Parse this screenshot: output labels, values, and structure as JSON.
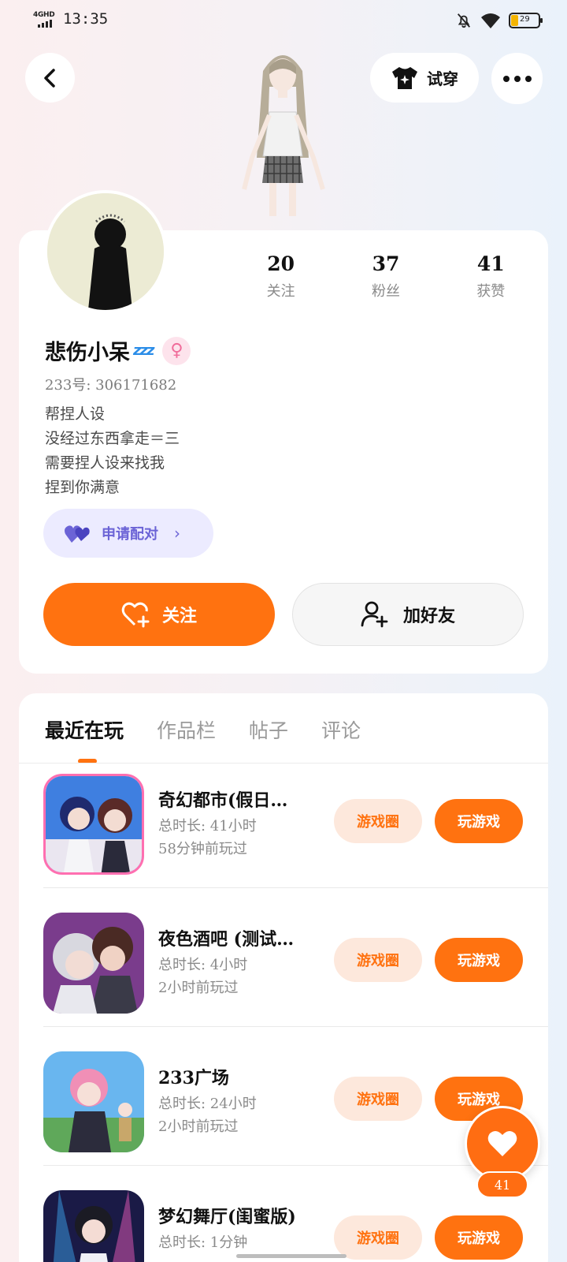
{
  "status_bar": {
    "network": "4GHD",
    "time": "13:35",
    "battery": "29"
  },
  "header": {
    "tryon_label": "试穿"
  },
  "profile": {
    "nickname": "悲伤小呆",
    "nickname_decoration": "zzz",
    "uid": "233号: 306171682",
    "bio": [
      "帮捏人设",
      "没经过东西拿走＝三",
      "需要捏人设来找我",
      "捏到你满意"
    ],
    "stats": [
      {
        "value": "20",
        "label": "关注"
      },
      {
        "value": "37",
        "label": "粉丝"
      },
      {
        "value": "41",
        "label": "获赞"
      }
    ],
    "pair_label": "申请配对",
    "follow_label": "关注",
    "add_friend_label": "加好友"
  },
  "tabs": [
    {
      "label": "最近在玩",
      "active": true
    },
    {
      "label": "作品栏",
      "active": false
    },
    {
      "label": "帖子",
      "active": false
    },
    {
      "label": "评论",
      "active": false
    }
  ],
  "games": [
    {
      "name": "奇幻都市(假日…",
      "total": "总时长: 41小时",
      "last": "58分钟前玩过",
      "circle_label": "游戏圈",
      "play_label": "玩游戏"
    },
    {
      "name": "夜色酒吧 (测试…",
      "total": "总时长: 4小时",
      "last": "2小时前玩过",
      "circle_label": "游戏圈",
      "play_label": "玩游戏"
    },
    {
      "name": "233广场",
      "total": "总时长: 24小时",
      "last": "2小时前玩过",
      "circle_label": "游戏圈",
      "play_label": "玩游戏"
    },
    {
      "name": "梦幻舞厅(闺蜜版)",
      "total": "总时长: 1分钟",
      "last": "",
      "circle_label": "游戏圈",
      "play_label": "玩游戏"
    }
  ],
  "like_fab": {
    "count": "41"
  },
  "colors": {
    "accent": "#ff7210",
    "accent_soft": "#fde8dc",
    "pair_purple": "#6b63d6",
    "gender_pink": "#f06c9a"
  }
}
